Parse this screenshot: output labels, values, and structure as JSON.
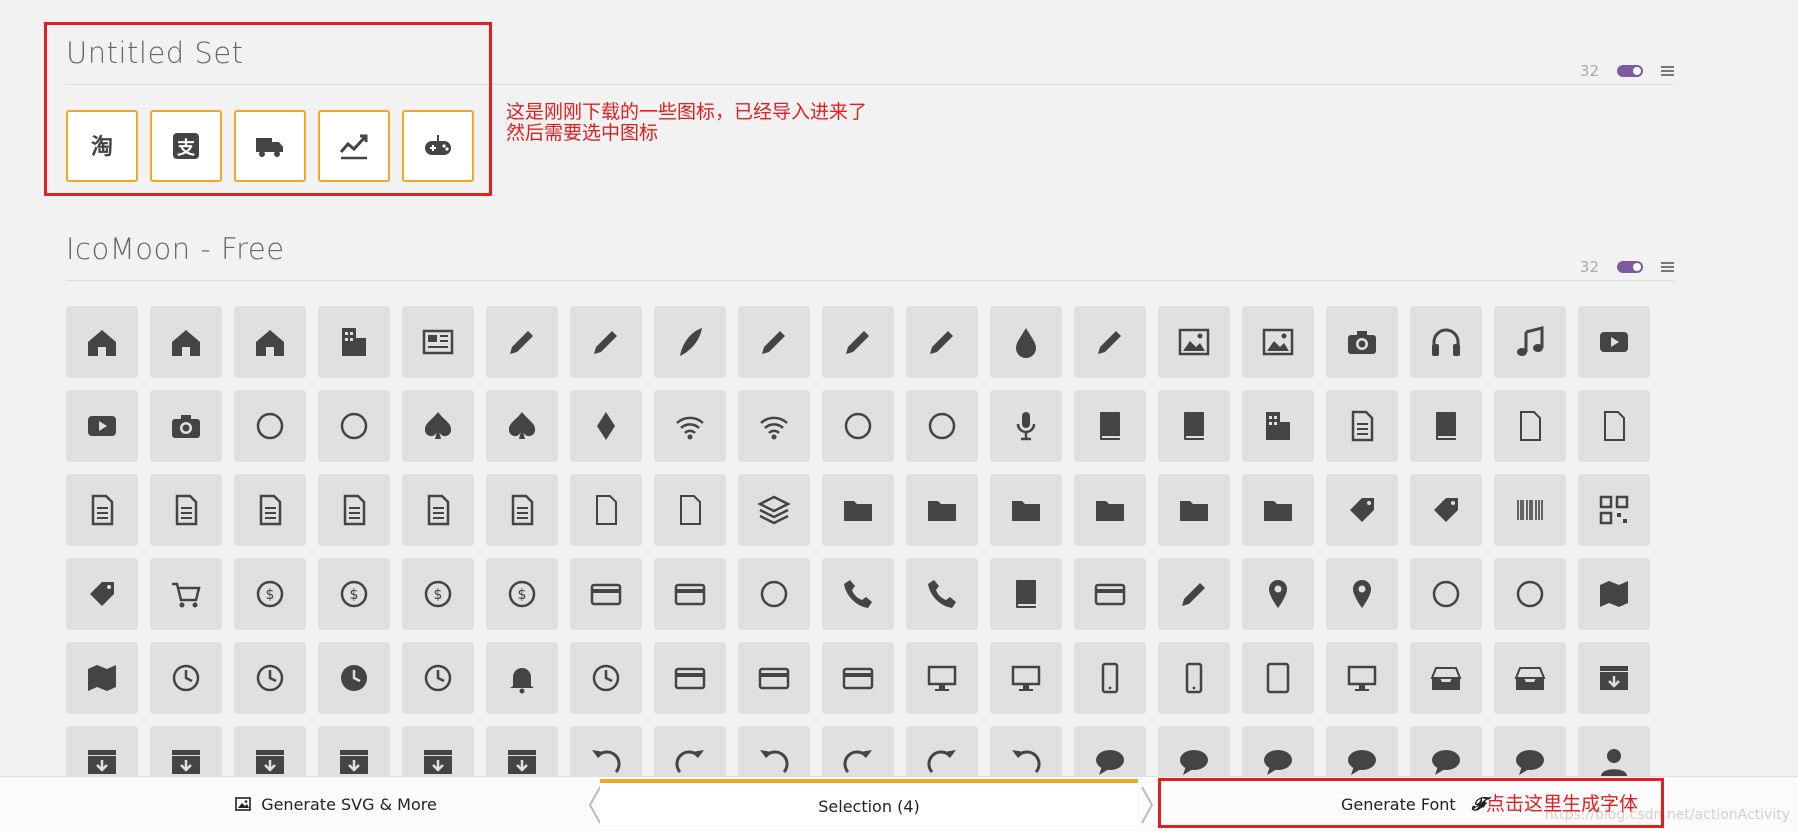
{
  "sets": {
    "untitled": {
      "title": "Untitled Set",
      "count": "32"
    },
    "icomoon": {
      "title": "IcoMoon - Free",
      "count": "32"
    }
  },
  "untitled_icons": [
    "taobao-icon",
    "alipay-icon",
    "truck-icon",
    "stock-chart-icon",
    "gamepad-icon"
  ],
  "icomoon_icons": [
    [
      "home-icon",
      "home2-icon",
      "home3-icon",
      "office-icon",
      "newspaper-icon",
      "pencil-icon",
      "pencil2-icon",
      "quill-icon",
      "pen-icon",
      "blog-icon",
      "eyedropper-icon",
      "droplet-icon",
      "paint-format-icon",
      "image-icon",
      "images-icon",
      "camera-icon",
      "headphones-icon",
      "music-icon",
      "play-icon"
    ],
    [
      "film-icon",
      "video-camera-icon",
      "dice-icon",
      "pacman-icon",
      "spades-icon",
      "clubs-icon",
      "diamonds-icon",
      "bullhorn-icon",
      "wifi-icon",
      "podcast-icon",
      "feed-icon",
      "mic-icon",
      "book-icon",
      "books-icon",
      "library-icon",
      "file-text-icon",
      "profile-icon",
      "file-empty-icon",
      "files-empty-icon"
    ],
    [
      "file-text2-icon",
      "file-picture-icon",
      "file-music-icon",
      "file-play-icon",
      "file-video-icon",
      "file-zip-icon",
      "copy-icon",
      "paste-icon",
      "stack-icon",
      "folder-icon",
      "folder-open-icon",
      "folder-plus-icon",
      "folder-minus-icon",
      "folder-download-icon",
      "folder-upload-icon",
      "price-tag-icon",
      "price-tags-icon",
      "barcode-icon",
      "qrcode-icon"
    ],
    [
      "ticket-icon",
      "cart-icon",
      "coin-dollar-icon",
      "coin-euro-icon",
      "coin-pound-icon",
      "coin-yen-icon",
      "credit-card-icon",
      "calculator-icon",
      "lifebuoy-icon",
      "phone-icon",
      "phone-hang-up-icon",
      "address-book-icon",
      "envelop-icon",
      "pushpin-icon",
      "location-icon",
      "location2-icon",
      "compass-icon",
      "compass2-icon",
      "map-icon"
    ],
    [
      "map2-icon",
      "history-icon",
      "clock-icon",
      "clock2-icon",
      "alarm-icon",
      "bell-icon",
      "stopwatch-icon",
      "calendar-icon",
      "printer-icon",
      "keyboard-icon",
      "display-icon",
      "laptop-icon",
      "mobile-icon",
      "mobile2-icon",
      "tablet-icon",
      "tv-icon",
      "drawer-icon",
      "drawer2-icon",
      "box-add-icon"
    ],
    [
      "box-remove-icon",
      "download-icon",
      "upload-icon",
      "floppy-disk-icon",
      "drive-icon",
      "database-icon",
      "undo-icon",
      "redo-icon",
      "undo2-icon",
      "redo2-icon",
      "forward-icon",
      "reply-icon",
      "bubble-icon",
      "bubbles-icon",
      "bubbles2-icon",
      "bubble2-icon",
      "bubbles3-icon",
      "bubbles4-icon",
      "user-icon"
    ]
  ],
  "annotations": {
    "note1_line1": "这是刚刚下载的一些图标，已经导入进来了",
    "note1_line2": "然后需要选中图标",
    "note2": "点击这里生成字体"
  },
  "bottom_bar": {
    "generate_svg": "Generate SVG & More",
    "selection": "Selection (4)",
    "generate_font": "Generate Font"
  },
  "watermark": "https://blog.csdn.net/actionActivity",
  "colors": {
    "accent": "#f5a623",
    "toggle": "#7c5c9e",
    "annotation": "#e02020",
    "tile": "#e0e0e0",
    "glyph": "#444444"
  }
}
